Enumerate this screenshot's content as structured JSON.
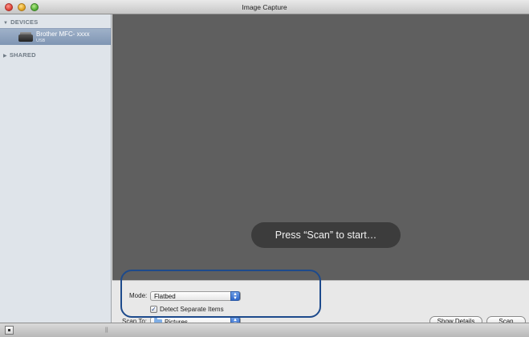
{
  "window": {
    "title": "Image Capture"
  },
  "sidebar": {
    "devices_header": "DEVICES",
    "shared_header": "SHARED",
    "device": {
      "name": "Brother MFC- xxxx",
      "connection": "USB"
    }
  },
  "main": {
    "hint": "Press “Scan” to start…"
  },
  "options": {
    "mode_label": "Mode:",
    "mode_value": "Flatbed",
    "detect_label": "Detect Separate Items",
    "detect_checked": true,
    "scan_to_label": "Scan To:",
    "scan_to_value": "Pictures"
  },
  "buttons": {
    "show_details": "Show Details",
    "scan": "Scan"
  },
  "colors": {
    "selection": "#8a9fbc",
    "preview_bg": "#5f5f5f",
    "annotation": "#1d4a8c"
  },
  "icons": [
    "close-icon",
    "minimize-icon",
    "zoom-icon",
    "printer-icon",
    "folder-icon",
    "popup-arrows-icon",
    "checkmark-icon",
    "sidebar-toggle-icon"
  ]
}
